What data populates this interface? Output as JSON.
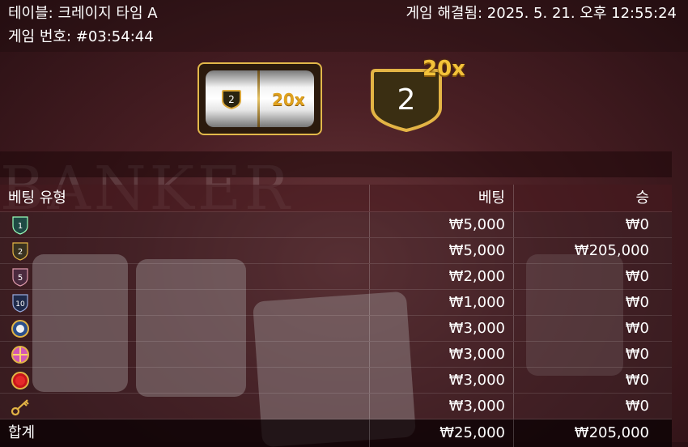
{
  "header": {
    "table_name": "테이블: 크레이지 타임 A",
    "game_number": "게임 번호: #03:54:44",
    "resolved_at": "게임 해결됨: 2025. 5. 21. 오후 12:55:24"
  },
  "result": {
    "slot_segment": "2",
    "slot_multiplier": "20x",
    "wheel_segment": "2",
    "wheel_multiplier": "20x"
  },
  "background_text": "BANKER",
  "table": {
    "col_bet_type": "베팅 유형",
    "col_bet": "베팅",
    "col_win": "승",
    "rows": [
      {
        "icon": "segment-1-icon",
        "label": "1",
        "bet": "₩5,000",
        "win": "₩0"
      },
      {
        "icon": "segment-2-icon",
        "label": "2",
        "bet": "₩5,000",
        "win": "₩205,000"
      },
      {
        "icon": "segment-5-icon",
        "label": "5",
        "bet": "₩2,000",
        "win": "₩0"
      },
      {
        "icon": "segment-10-icon",
        "label": "10",
        "bet": "₩1,000",
        "win": "₩0"
      },
      {
        "icon": "coin-flip-icon",
        "bet": "₩3,000",
        "win": "₩0"
      },
      {
        "icon": "pachinko-icon",
        "bet": "₩3,000",
        "win": "₩0"
      },
      {
        "icon": "cash-hunt-icon",
        "bet": "₩3,000",
        "win": "₩0"
      },
      {
        "icon": "crazy-time-key-icon",
        "bet": "₩3,000",
        "win": "₩0"
      }
    ],
    "total_label": "합계",
    "total_bet": "₩25,000",
    "total_win": "₩205,000"
  },
  "colors": {
    "gold": "#e2b84a",
    "seg1": "#1f4a44",
    "seg2": "#3a3320",
    "seg5": "#4a2a3e",
    "seg10": "#1f2a4a"
  }
}
